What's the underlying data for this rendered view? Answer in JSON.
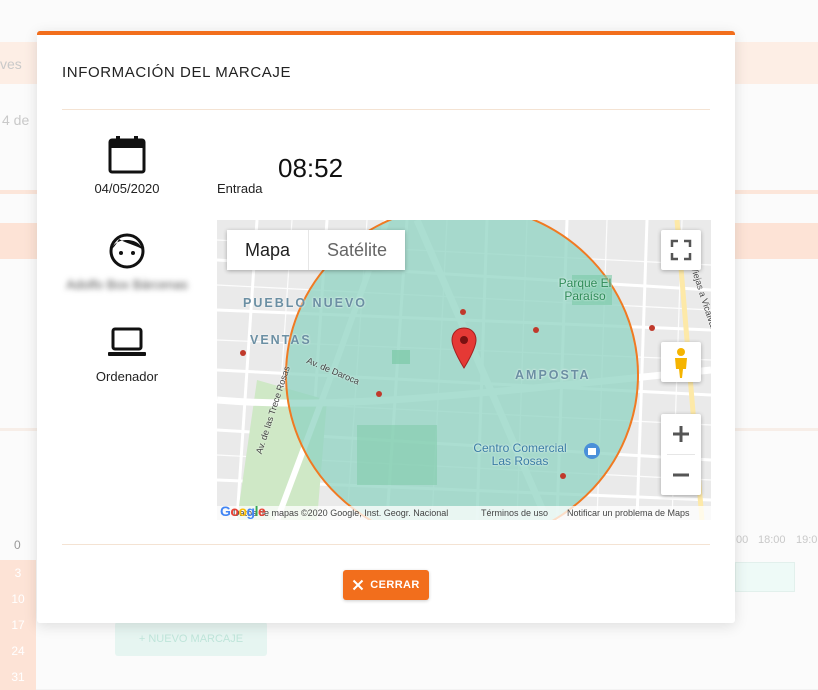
{
  "background": {
    "tab_fragment": "ves",
    "date_fragment": "4 de",
    "row_numbers": [
      "0",
      "3",
      "10",
      "17",
      "24",
      "31"
    ],
    "times": [
      "00",
      "18:00",
      "19:0"
    ],
    "new_button": "NUEVO MARCAJE"
  },
  "modal": {
    "title": "INFORMACIÓN DEL MARCAJE",
    "date": "04/05/2020",
    "user_name": "Adolfo Box Bárcenas",
    "device": "Ordenador",
    "entry_label": "Entrada",
    "entry_time": "08:52",
    "close_label": "CERRAR"
  },
  "map": {
    "type_map": "Mapa",
    "type_satellite": "Satélite",
    "labels": {
      "pueblo_nuevo": "PUEBLO NUEVO",
      "ventas": "VENTAS",
      "amposta": "AMPOSTA",
      "parque": "Parque El Paraíso",
      "centro": "Centro Comercial Las Rosas",
      "calle_daroca": "Av. de Daroca",
      "calle_trece_rosas": "Av. de las Trece Rosas",
      "calle_vicalvaro": "Viejas a Vicálvaro"
    },
    "footer": {
      "data": "Datos de mapas ©2020 Google, Inst. Geogr. Nacional",
      "terms": "Términos de uso",
      "report": "Notificar un problema de Maps"
    },
    "logo": "Google"
  },
  "colors": {
    "accent": "#f26e1c",
    "geofence_fill": "#8fd3c1",
    "geofence_stroke": "#f07a22",
    "marker": "#e53935"
  }
}
